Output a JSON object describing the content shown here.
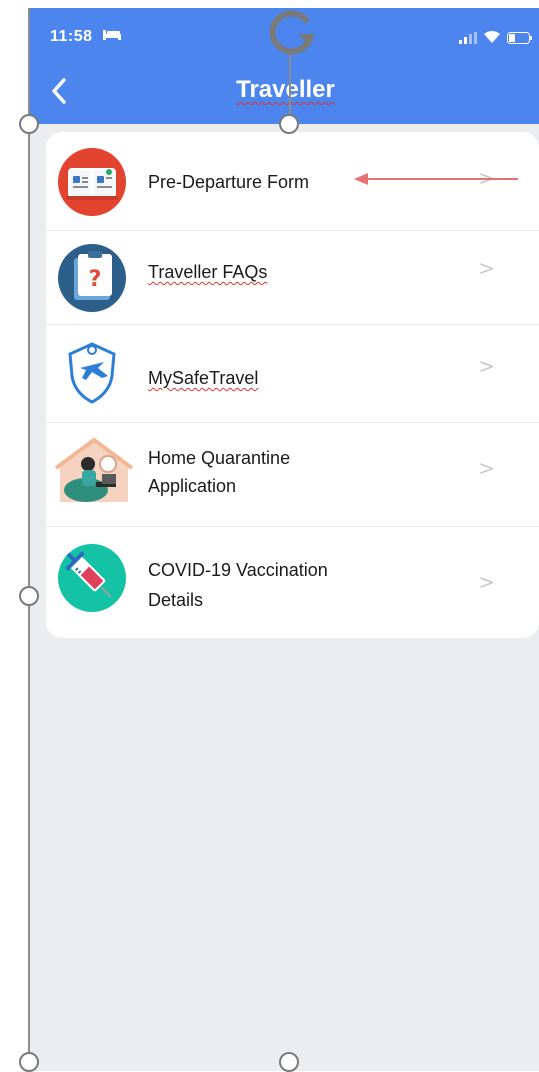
{
  "status": {
    "time": "11:58"
  },
  "header": {
    "title": "Traveller"
  },
  "menu": {
    "items": [
      {
        "label": "Pre-Departure Form",
        "chevron": ">"
      },
      {
        "label": "Traveller FAQs",
        "chevron": ">"
      },
      {
        "label": "MySafeTravel",
        "chevron": ">"
      },
      {
        "label_line1": "Home Quarantine",
        "label_line2": "Application",
        "chevron": ">"
      },
      {
        "label_line1": "COVID-19 Vaccination",
        "label_line2": "Details",
        "chevron": ">"
      }
    ]
  },
  "colors": {
    "appbar": "#4c85ee",
    "background": "#ebedee",
    "annotation_arrow": "#e57373"
  },
  "icons": [
    "bed-icon",
    "signal-icon",
    "wifi-icon",
    "battery-icon",
    "back-chevron-icon",
    "form-book-icon",
    "faq-document-icon",
    "shield-airplane-icon",
    "home-quarantine-icon",
    "vaccine-syringe-icon",
    "rotate-handle-icon"
  ]
}
